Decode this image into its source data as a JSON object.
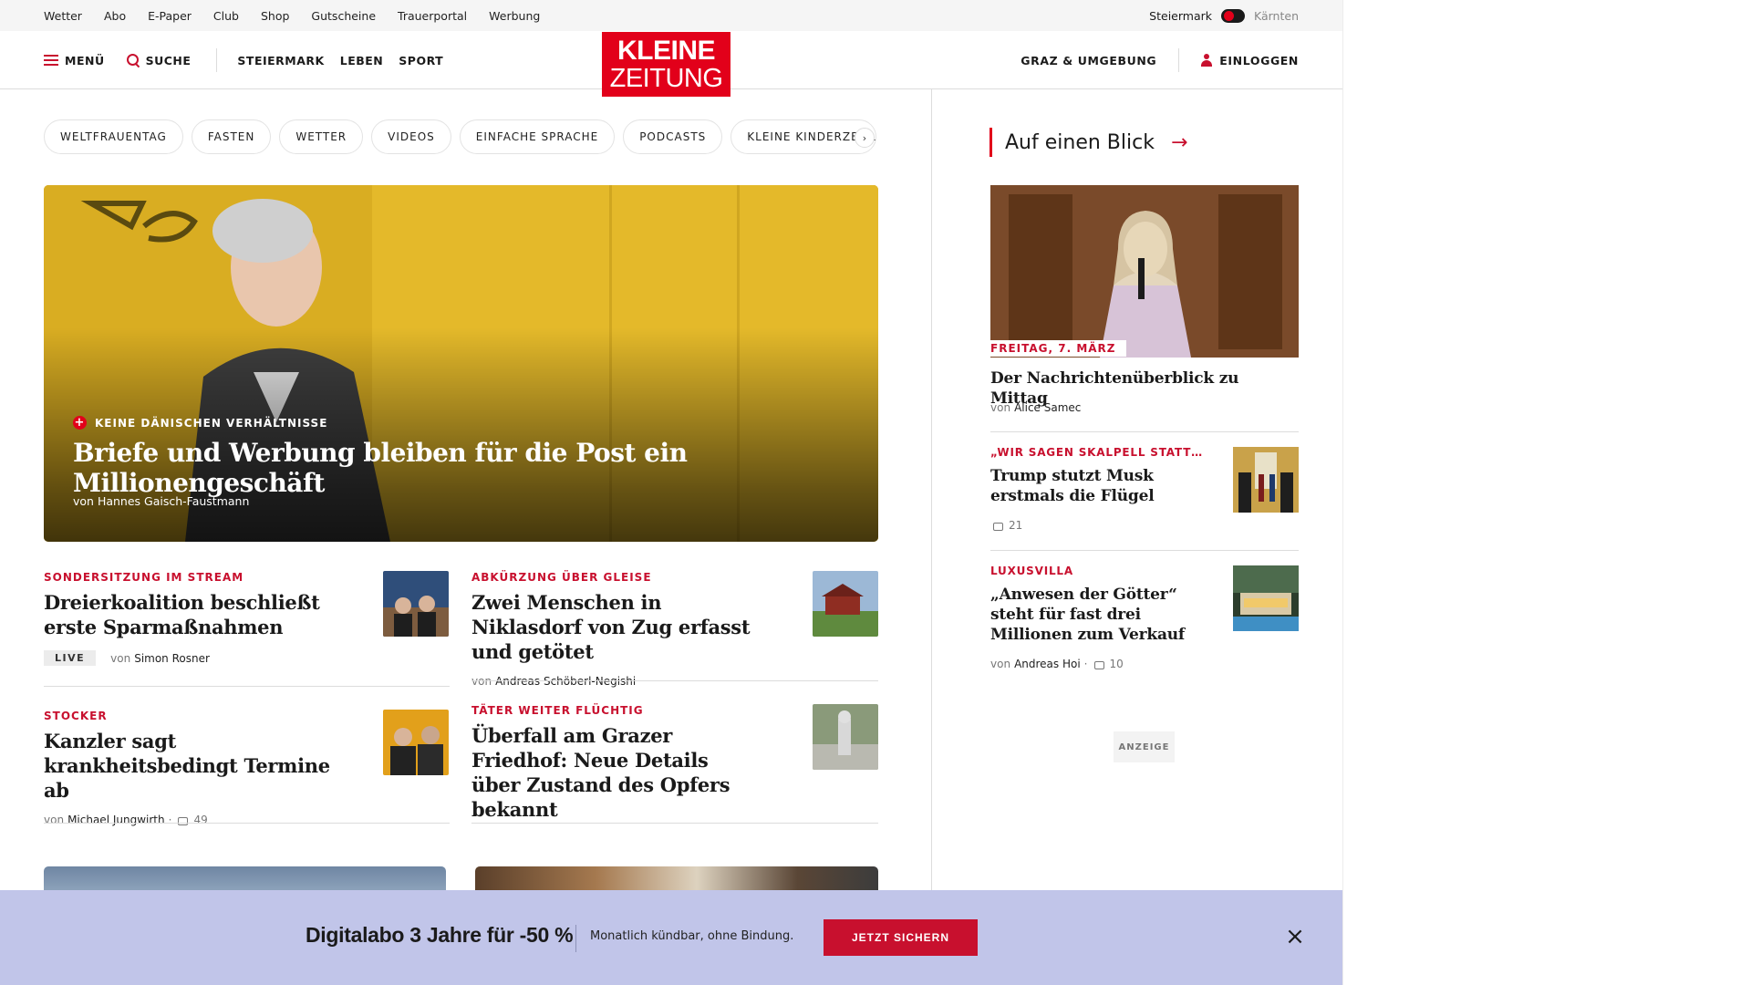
{
  "metabar": {
    "links": [
      "Wetter",
      "Abo",
      "E-Paper",
      "Club",
      "Shop",
      "Gutscheine",
      "Trauerportal",
      "Werbung"
    ],
    "region_active": "Steiermark",
    "region_inactive": "Kärnten"
  },
  "header": {
    "menu": "MENÜ",
    "search": "SUCHE",
    "nav": [
      "STEIERMARK",
      "LEBEN",
      "SPORT"
    ],
    "logo_line1": "KLEINE",
    "logo_line2": "ZEITUNG",
    "region_link": "GRAZ & UMGEBUNG",
    "login": "EINLOGGEN"
  },
  "chips": [
    "WELTFRAUENTAG",
    "FASTEN",
    "WETTER",
    "VIDEOS",
    "EINFACHE SPRACHE",
    "PODCASTS",
    "KLEINE KINDERZEITUNG"
  ],
  "hero": {
    "kicker": "KEINE DÄNISCHEN VERHÄLTNISSE",
    "title": "Briefe und Werbung bleiben für die Post ein Millionengeschäft",
    "byline_prefix": "von",
    "author": "Hannes Gaisch-Faustmann"
  },
  "articles": [
    {
      "kicker": "SONDERSITZUNG IM STREAM",
      "title": "Dreierkoalition beschließt erste Sparmaßnahmen",
      "badge": "LIVE",
      "byline_prefix": "von",
      "author": "Simon Rosner"
    },
    {
      "kicker": "ABKÜRZUNG ÜBER GLEISE",
      "title": "Zwei Menschen in Niklasdorf von Zug erfasst und getötet",
      "byline_prefix": "von",
      "author": "Andreas Schöberl-Negishi"
    },
    {
      "kicker": "STOCKER",
      "title": "Kanzler sagt krankheitsbedingt Termine ab",
      "byline_prefix": "von",
      "author": "Michael Jungwirth",
      "comments": "49"
    },
    {
      "kicker": "TÄTER WEITER FLÜCHTIG",
      "title": "Überfall am Grazer Friedhof: Neue Details über Zustand des Opfers bekannt"
    }
  ],
  "sidebar": {
    "heading": "Auf einen Blick",
    "lead": {
      "date": "FREITAG, 7. MÄRZ",
      "title": "Der Nachrichtenüberblick zu Mittag",
      "byline_prefix": "von",
      "author": "Alice Samec"
    },
    "items": [
      {
        "kicker": "„WIR SAGEN SKALPELL STATT…",
        "title": "Trump stutzt Musk erstmals die Flügel",
        "comments": "21"
      },
      {
        "kicker": "LUXUSVILLA",
        "title": "„Anwesen der Götter“ steht für fast drei Millionen zum Verkauf",
        "byline_prefix": "von",
        "author": "Andreas Hoi",
        "comments": "10"
      }
    ],
    "ad_label": "ANZEIGE"
  },
  "promo": {
    "title": "Digitalabo 3 Jahre für -50 %",
    "subtitle": "Monatlich kündbar, ohne Bindung.",
    "button": "JETZT SICHERN",
    "close": "×"
  },
  "colors": {
    "brand_red": "#e2001a",
    "kicker_red": "#c8102e",
    "promo_bg": "#c1c5e9"
  }
}
